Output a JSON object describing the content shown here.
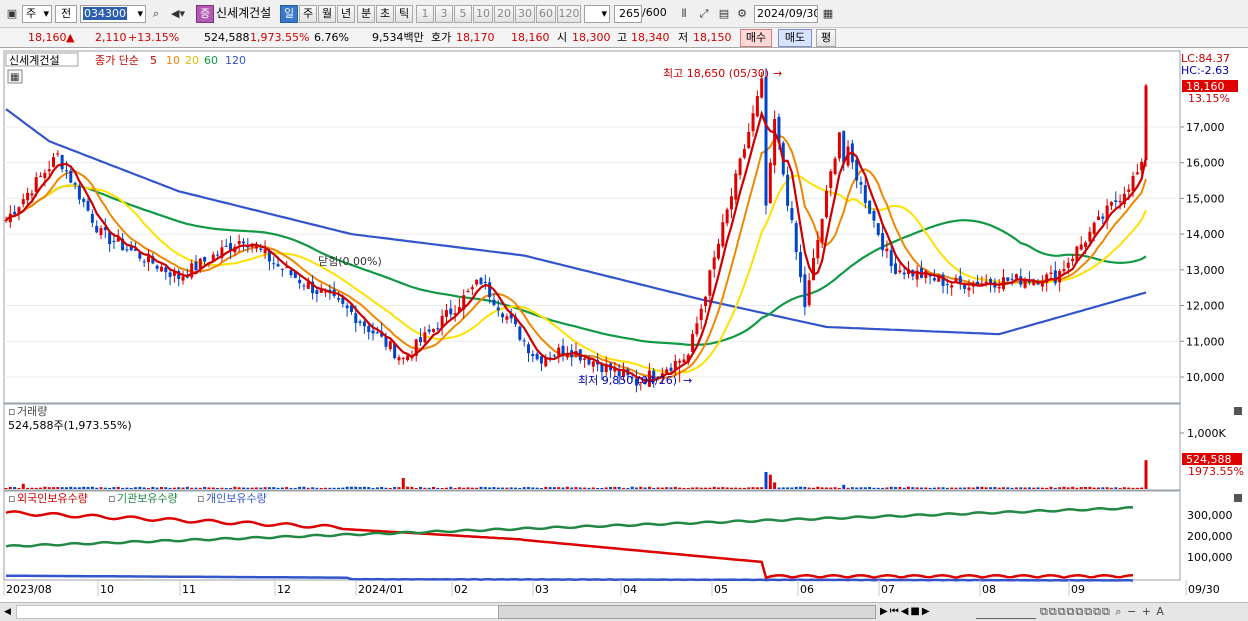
{
  "toolbar": {
    "period_prefix": "주",
    "period_sel": "전",
    "code": "034300",
    "name": "신세계건설",
    "buy_flag": "증",
    "timeframes": [
      "일",
      "주",
      "월",
      "년",
      "분",
      "초",
      "틱"
    ],
    "intervals": [
      "1",
      "3",
      "5",
      "10",
      "20",
      "30",
      "60",
      "120"
    ],
    "count": "265",
    "total": "/600",
    "date": "2024/09/30"
  },
  "quote": {
    "price": "18,160",
    "arrow": "▲",
    "change": "2,110",
    "pct": "+13.15%",
    "volume": "524,588",
    "vol_ratio": "1,973.55%",
    "turnover": "6.76%",
    "amount": "9,534백만",
    "bid_label": "호가",
    "bid": "18,170",
    "ask": "18,160",
    "open_label": "시",
    "open": "18,300",
    "high_label": "고",
    "high": "18,340",
    "low_label": "저",
    "low": "18,150",
    "buy": "매수",
    "sell": "매도",
    "avg": "평"
  },
  "price_panel": {
    "title": "신세계건설",
    "legend_prefix": "종가 단순",
    "ma": [
      {
        "label": "5",
        "color": "#cc0000"
      },
      {
        "label": "10",
        "color": "#ee8800"
      },
      {
        "label": "20",
        "color": "#e8c800"
      },
      {
        "label": "60",
        "color": "#119944"
      },
      {
        "label": "120",
        "color": "#3355cc"
      }
    ],
    "lc": "LC:84.37",
    "hc": "HC:-2.63",
    "current": "18,160",
    "current_pct": "13.15%",
    "high_note": "최고 18,650 (05/30)",
    "low_note": "최저 9,850 (04/26)",
    "prev_note": "닫힘(0.00%)"
  },
  "volume_panel": {
    "title": "거래량",
    "sub": "524,588주(1,973.55%)",
    "axis": "1,000K",
    "current": "524,588",
    "current_pct": "1973.55%"
  },
  "holding_panel": {
    "series": [
      {
        "label": "외국인보유수량",
        "color": "#cc0000"
      },
      {
        "label": "기관보유수량",
        "color": "#228844"
      },
      {
        "label": "개인보유수량",
        "color": "#3355cc"
      }
    ],
    "axis": [
      "300,000",
      "200,000",
      "100,000"
    ]
  },
  "x_labels": [
    "2023/08",
    "10",
    "11",
    "12",
    "2024/01",
    "02",
    "03",
    "04",
    "05",
    "06",
    "07",
    "08",
    "09",
    "09/30"
  ],
  "chart_data": {
    "type": "candlestick",
    "y_ticks": [
      10000,
      11000,
      12000,
      13000,
      14000,
      15000,
      16000,
      17000
    ],
    "key_points": [
      [
        "2023/08",
        14400
      ],
      [
        "2023/09",
        16200
      ],
      [
        "2023/10",
        14000
      ],
      [
        "2023/11",
        12800
      ],
      [
        "2023/11",
        13900
      ],
      [
        "2023/12",
        13100
      ],
      [
        "2024/01",
        11800
      ],
      [
        "2024/01",
        10500
      ],
      [
        "2024/02",
        12700
      ],
      [
        "2024/03",
        10500
      ],
      [
        "2024/04",
        10800
      ],
      [
        "2024/04",
        9850
      ],
      [
        "2024/05",
        10600
      ],
      [
        "2024/05",
        18650
      ],
      [
        "2024/06",
        12000
      ],
      [
        "2024/06",
        16900
      ],
      [
        "2024/07",
        13100
      ],
      [
        "2024/08",
        12600
      ],
      [
        "2024/09",
        12800
      ],
      [
        "2024/09",
        16000
      ]
    ],
    "ma120": [
      [
        0,
        17500
      ],
      [
        10,
        16600
      ],
      [
        40,
        15200
      ],
      [
        80,
        14000
      ],
      [
        120,
        13400
      ],
      [
        160,
        12200
      ],
      [
        190,
        11400
      ],
      [
        230,
        11200
      ],
      [
        265,
        12400
      ]
    ]
  }
}
